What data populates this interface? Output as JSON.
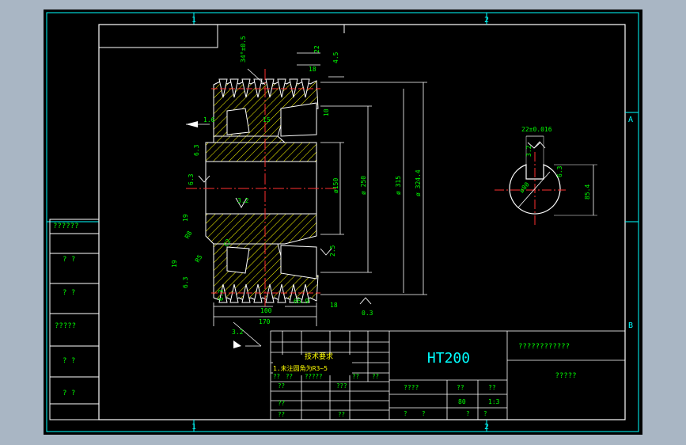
{
  "drawing": {
    "zone_numbers_top": [
      "1",
      "2"
    ],
    "zone_numbers_bottom": [
      "1",
      "2"
    ],
    "zone_letters_right": [
      "A",
      "B"
    ],
    "left_strip_labels": [
      "??????",
      "? ?",
      "? ?",
      "?????",
      "? ?",
      "? ?"
    ],
    "dimensions": {
      "pulley": [
        "34°±0.5",
        "22",
        "4.5",
        "18",
        "10",
        "1.6",
        "15",
        "3.2",
        "ø150",
        "ø 250",
        "ø 315",
        "ø 324.4",
        "6.3",
        "2.5",
        "6.3",
        "19",
        "R8",
        "R5",
        "C2",
        "19",
        "100",
        "65.9",
        "18",
        "170",
        "3.2",
        "0.3",
        "6.3",
        "6.3"
      ],
      "keyway": [
        "22±0.016",
        "3.2",
        "ø80",
        "6.3",
        "85.4"
      ]
    },
    "title_block": {
      "material": "HT200",
      "drawing_name": "????????????",
      "company": "?????",
      "tech_title": "技术要求",
      "tech_note": "1.未注圆角为R3~5",
      "scale_label": "????",
      "scale_value": "1:3",
      "quantity_label": "??",
      "weight_value": "80",
      "header_cells": [
        "??",
        "??",
        "?????",
        "??",
        "???",
        "??"
      ],
      "row_cells": [
        "??",
        "??",
        "??",
        "??",
        "??",
        "??",
        "??",
        "?",
        "?",
        "?",
        "?"
      ]
    }
  }
}
